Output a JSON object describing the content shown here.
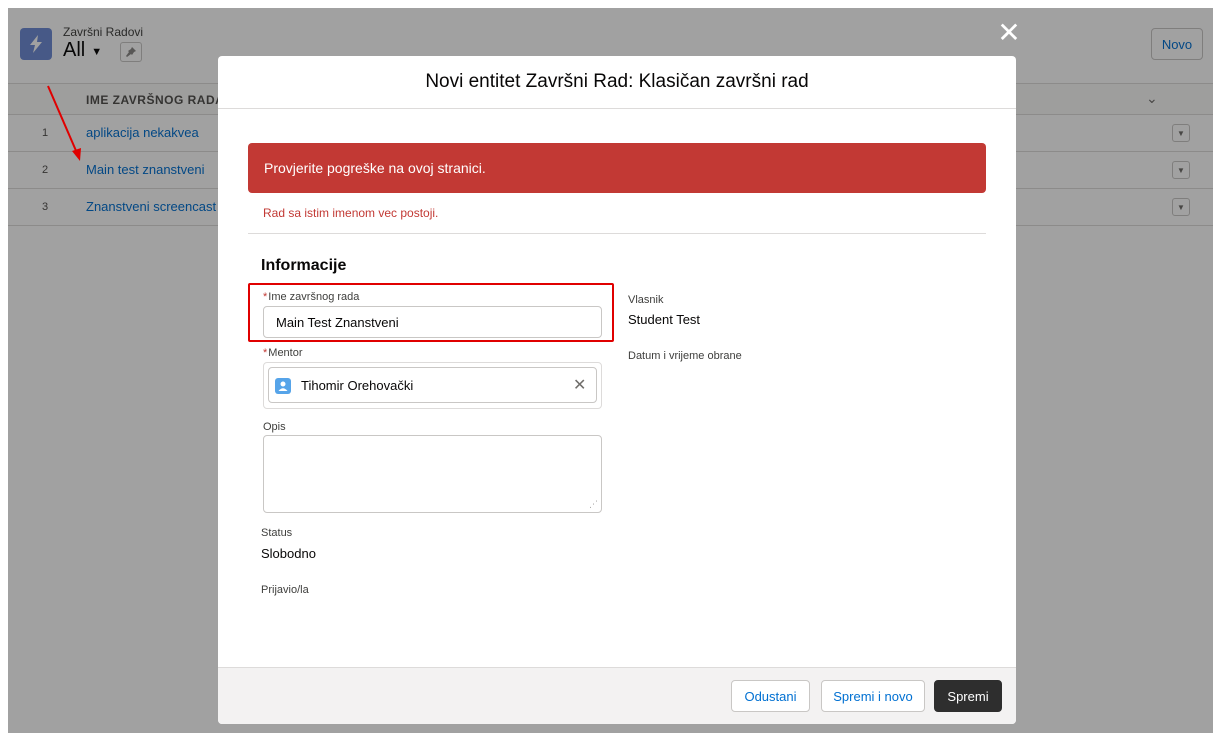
{
  "list_view": {
    "object_label": "Završni Radovi",
    "view_name": "All",
    "new_button": "Novo",
    "column_header": "IME ZAVRŠNOG RADA",
    "rows": [
      {
        "num": "1",
        "name": "aplikacija nekakvea"
      },
      {
        "num": "2",
        "name": "Main test znanstveni"
      },
      {
        "num": "3",
        "name": "Znanstveni screencast"
      }
    ]
  },
  "modal": {
    "title": "Novi entitet Završni Rad: Klasičan završni rad",
    "error_banner": "Provjerite pogreške na ovoj stranici.",
    "error_message": "Rad sa istim imenom vec postoji.",
    "section_title": "Informacije",
    "fields": {
      "name_label": "Ime završnog rada",
      "name_value": "Main Test Znanstveni",
      "mentor_label": "Mentor",
      "mentor_value": "Tihomir Orehovački",
      "opis_label": "Opis",
      "opis_value": "",
      "status_label": "Status",
      "status_value": "Slobodno",
      "prijavio_label": "Prijavio/la",
      "vlasnik_label": "Vlasnik",
      "vlasnik_value": "Student Test",
      "datum_label": "Datum i vrijeme obrane"
    },
    "footer": {
      "cancel": "Odustani",
      "save_new": "Spremi i novo",
      "save": "Spremi"
    }
  },
  "colors": {
    "error": "#c23934",
    "brand_button": "#2e2e2e",
    "link": "#0070d2",
    "highlight_annotation": "#e00000"
  },
  "icons": [
    "lightning-icon",
    "caret-down-icon",
    "pin-icon",
    "chevron-down-icon",
    "row-menu-icon",
    "close-icon",
    "contact-icon",
    "clear-icon",
    "resize-handle-icon"
  ]
}
